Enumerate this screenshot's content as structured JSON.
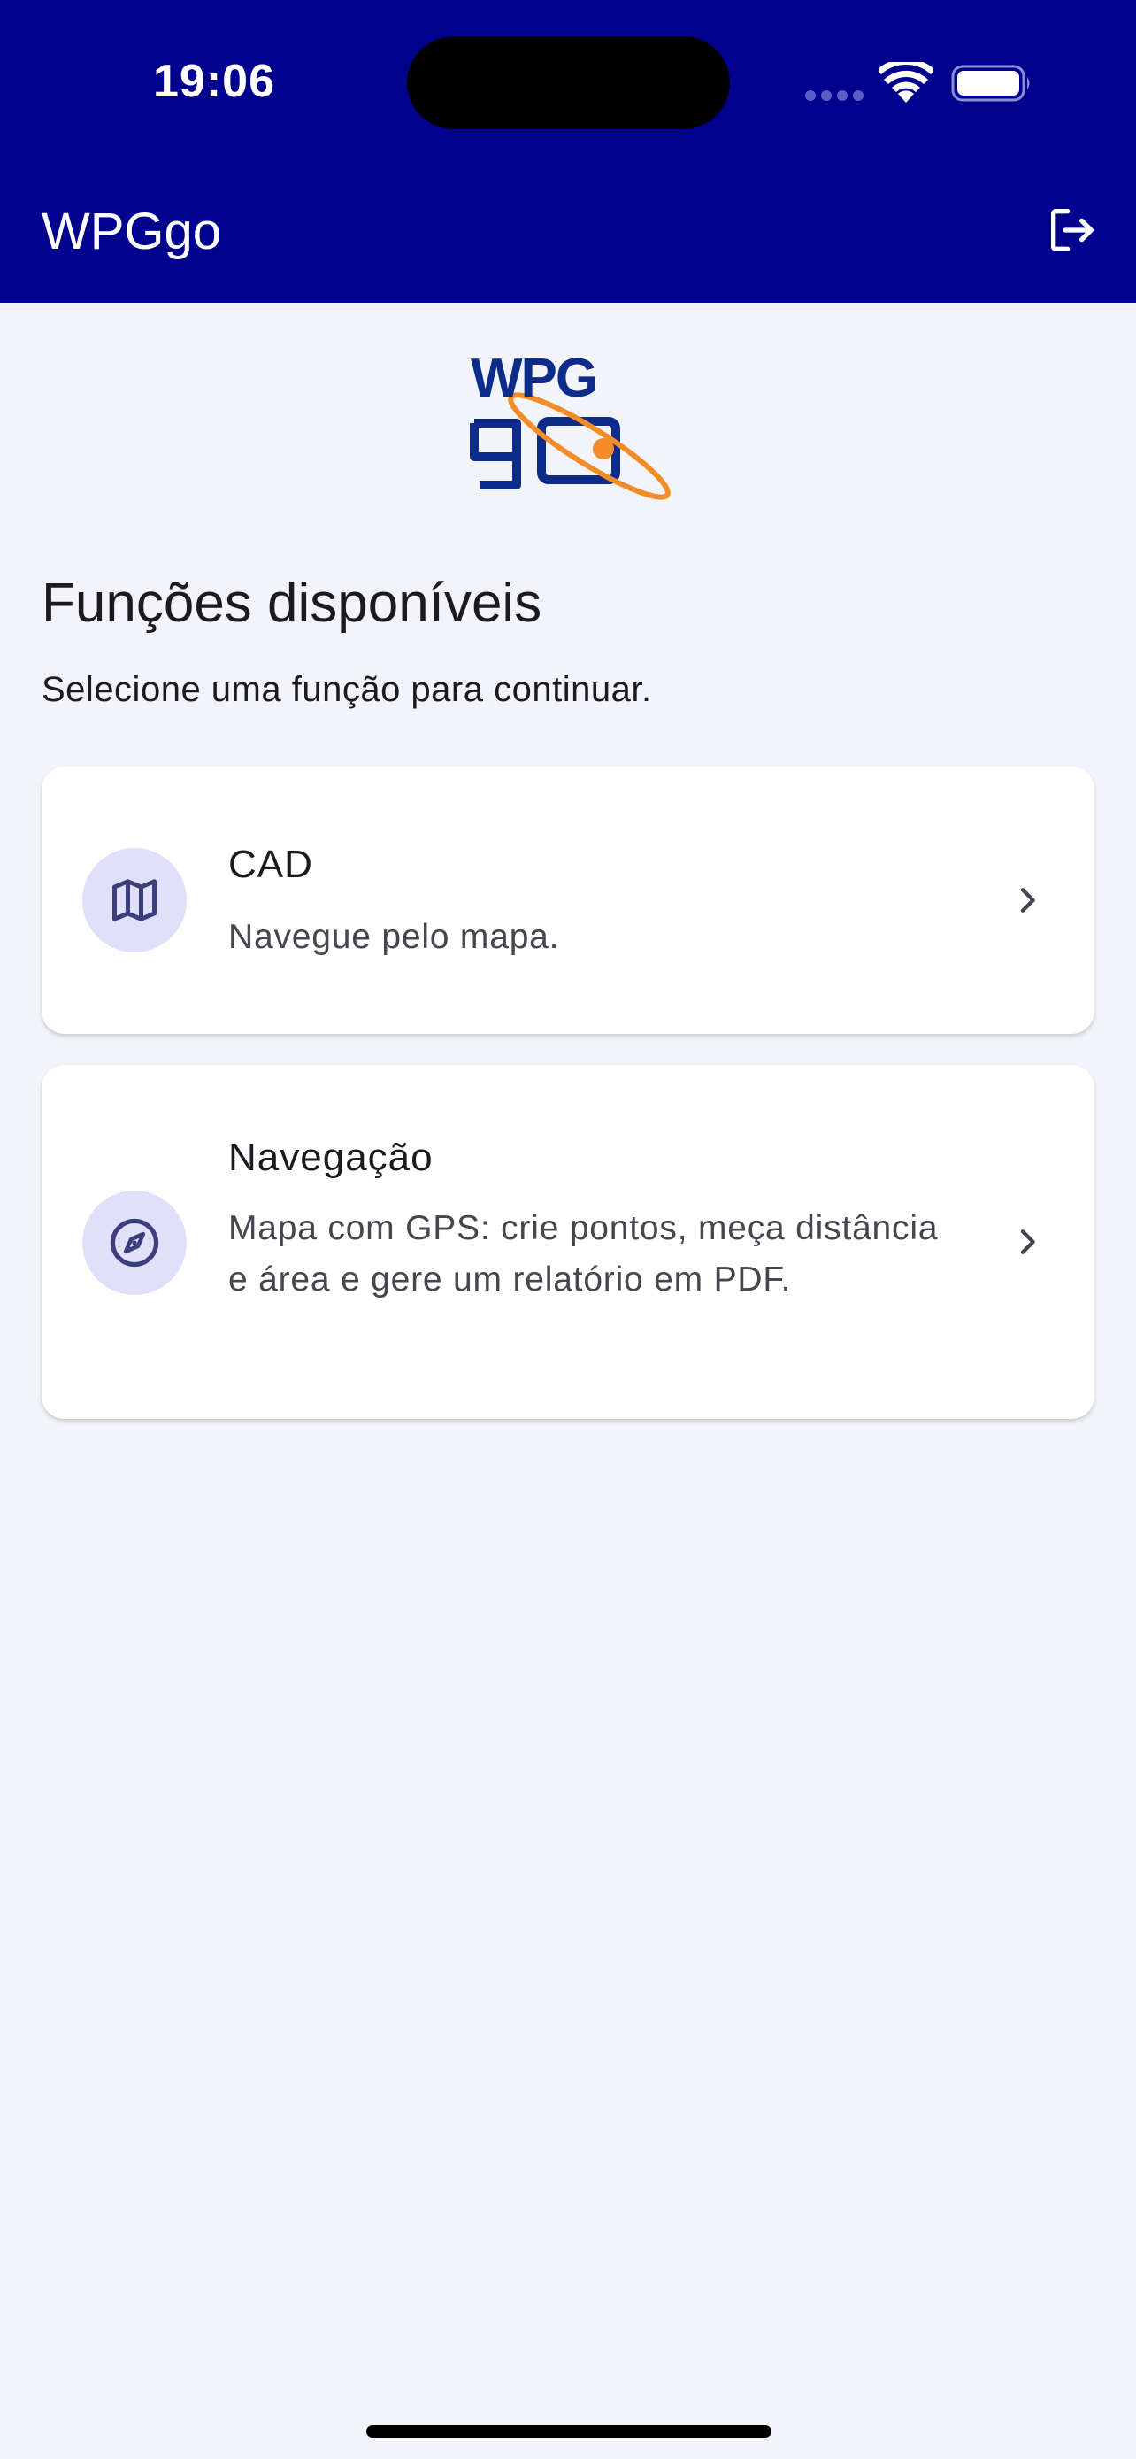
{
  "status_bar": {
    "time": "19:06"
  },
  "app_bar": {
    "title": "WPGgo",
    "logout_icon": "logout-icon"
  },
  "logo": {
    "top_text": "WPG",
    "bottom_text": "go",
    "brand_color": "#0d2c8a",
    "accent_color": "#f28c28"
  },
  "main": {
    "title": "Funções disponíveis",
    "subtitle": "Selecione uma função para continuar.",
    "functions": [
      {
        "title": "CAD",
        "description": "Navegue pelo mapa.",
        "icon": "map-icon"
      },
      {
        "title": "Navegação",
        "description": "Mapa com GPS: crie pontos, meça distância e área e gere um relatório em PDF.",
        "icon": "compass-icon"
      }
    ]
  },
  "colors": {
    "header_bg": "#00028e",
    "page_bg": "#f3f4f9",
    "icon_circle_bg": "#e0e0fa",
    "icon_color": "#3c3f7a"
  }
}
